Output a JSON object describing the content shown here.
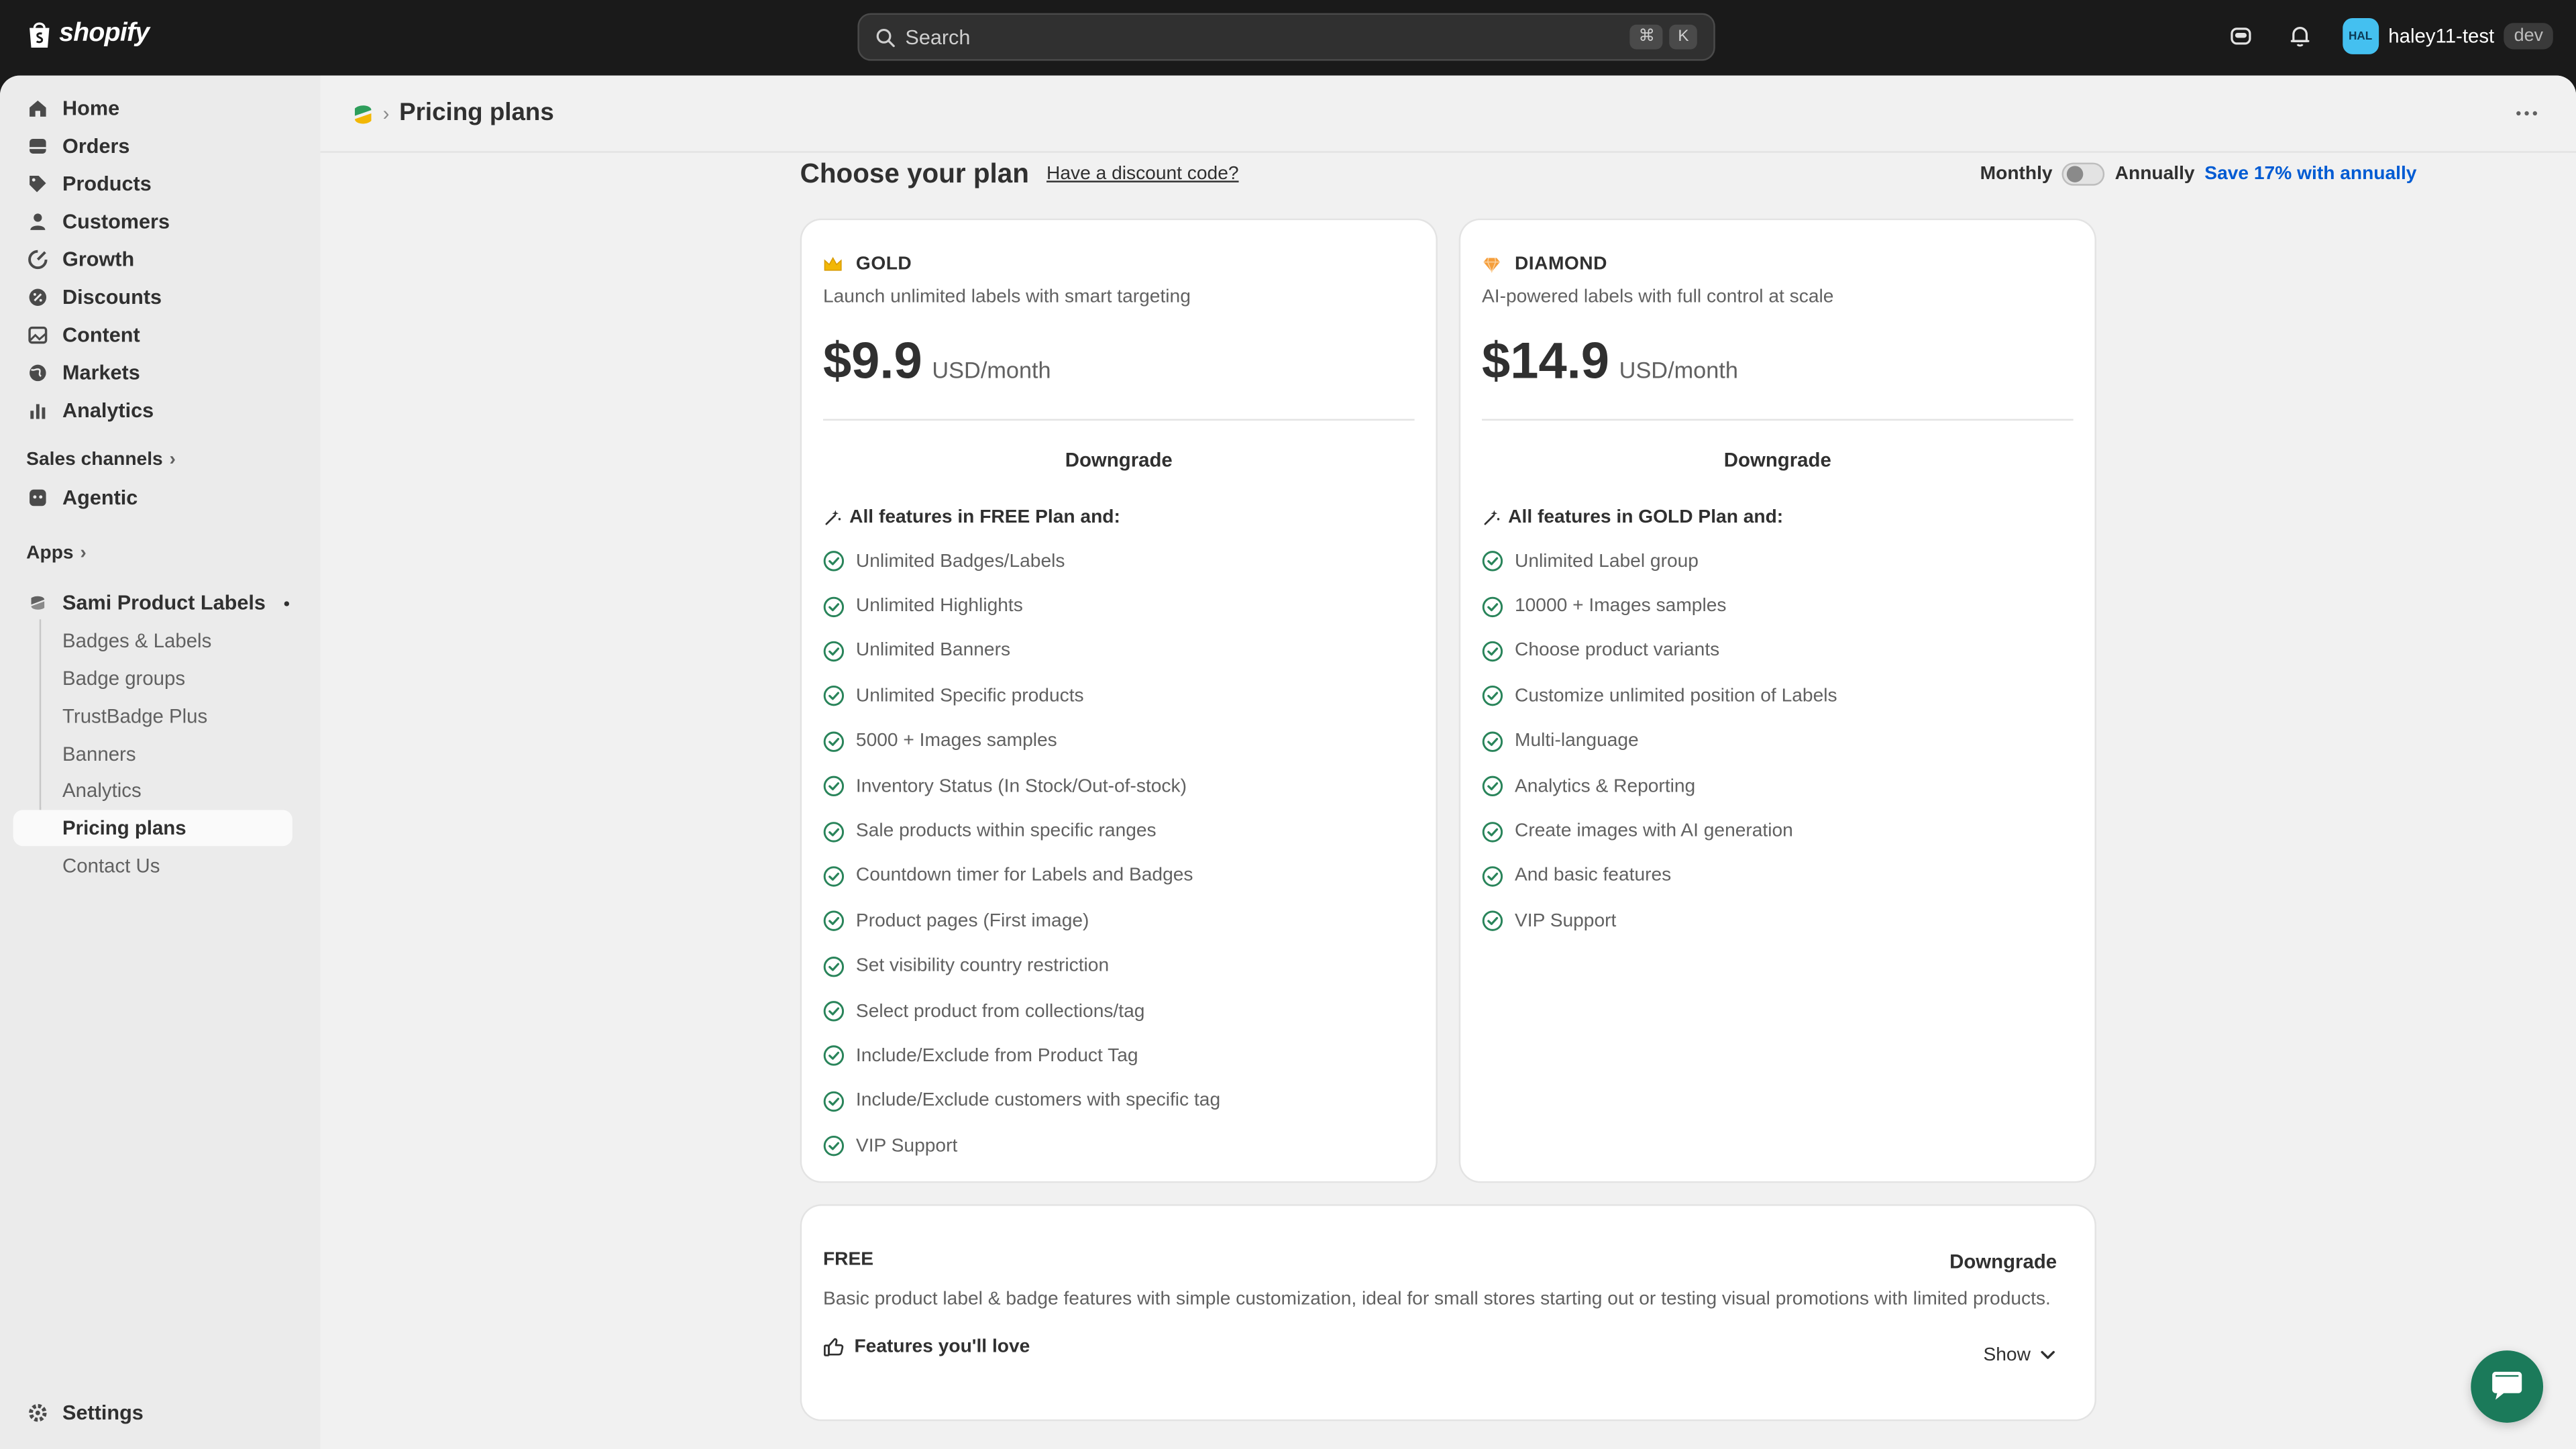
{
  "topbar": {
    "logo_text": "shopify",
    "search_placeholder": "Search",
    "shortcut_cmd": "⌘",
    "shortcut_key": "K",
    "avatar_initials": "HAL",
    "store_name": "haley11-test",
    "store_tag": "dev"
  },
  "sidebar": {
    "items": [
      {
        "label": "Home",
        "icon": "home-icon"
      },
      {
        "label": "Orders",
        "icon": "orders-icon"
      },
      {
        "label": "Products",
        "icon": "tag-icon"
      },
      {
        "label": "Customers",
        "icon": "person-icon"
      },
      {
        "label": "Growth",
        "icon": "growth-icon"
      },
      {
        "label": "Discounts",
        "icon": "discount-icon"
      },
      {
        "label": "Content",
        "icon": "content-icon"
      },
      {
        "label": "Markets",
        "icon": "globe-icon"
      },
      {
        "label": "Analytics",
        "icon": "chart-icon"
      }
    ],
    "sales_channels_label": "Sales channels",
    "agentic_label": "Agentic",
    "apps_label": "Apps",
    "app_name": "Sami Product Labels",
    "app_sub_items": [
      "Badges & Labels",
      "Badge groups",
      "TrustBadge Plus",
      "Banners",
      "Analytics",
      "Pricing plans",
      "Contact Us"
    ],
    "settings_label": "Settings"
  },
  "page": {
    "title": "Pricing plans",
    "choose_title": "Choose your plan",
    "discount_link": "Have a discount code?",
    "billing_monthly": "Monthly",
    "billing_annually": "Annually",
    "save_note": "Save 17% with annually"
  },
  "plans": {
    "gold": {
      "name": "GOLD",
      "description": "Launch unlimited labels with smart targeting",
      "price": "$9.9",
      "unit": "USD/month",
      "action": "Downgrade",
      "features_heading": "All features in FREE Plan and:",
      "features": [
        "Unlimited Badges/Labels",
        "Unlimited Highlights",
        "Unlimited Banners",
        "Unlimited Specific products",
        "5000 + Images samples",
        "Inventory Status (In Stock/Out-of-stock)",
        "Sale products within specific ranges",
        "Countdown timer for Labels and Badges",
        "Product pages (First image)",
        "Set visibility country restriction",
        "Select product from collections/tag",
        "Include/Exclude from Product Tag",
        "Include/Exclude customers with specific tag",
        "VIP Support"
      ]
    },
    "diamond": {
      "name": "DIAMOND",
      "description": "AI-powered labels with full control at scale",
      "price": "$14.9",
      "unit": "USD/month",
      "action": "Downgrade",
      "features_heading": "All features in GOLD Plan and:",
      "features": [
        "Unlimited Label group",
        "10000 + Images samples",
        "Choose product variants",
        "Customize unlimited position of Labels",
        "Multi-language",
        "Analytics & Reporting",
        "Create images with AI generation",
        "And basic features",
        "VIP Support"
      ]
    },
    "free": {
      "name": "FREE",
      "action": "Downgrade",
      "description": "Basic product label & badge features with simple customization, ideal for small stores starting out or testing visual promotions with limited products.",
      "features_label": "Features you'll love",
      "show_label": "Show"
    }
  },
  "colors": {
    "accent_blue": "#005bd3",
    "check_green": "#29845a",
    "chat_green": "#1b7a5a"
  }
}
